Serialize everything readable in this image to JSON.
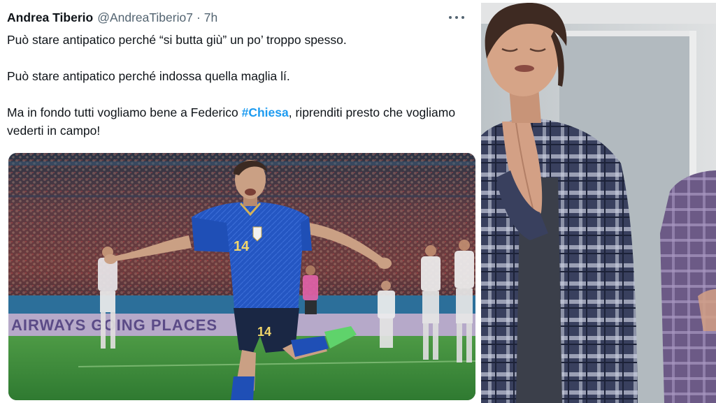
{
  "tweet": {
    "author_name": "Andrea Tiberio",
    "author_handle": "@AndreaTiberio7",
    "separator": "·",
    "time": "7h",
    "paragraphs": [
      "Può stare antipatico perché “si butta giù” un po’ troppo spesso.",
      "Può stare antipatico perché indossa quella maglia lí."
    ],
    "last_paragraph_before": "Ma in fondo tutti vogliamo bene a Federico ",
    "hashtag": "#Chiesa",
    "last_paragraph_after": ", riprenditi presto che vogliamo vederti in campo!",
    "media": {
      "jersey_number": "14",
      "banner_text": "AIRWAYS   GOING PLACES"
    }
  },
  "colors": {
    "hashtag": "#1d9bf0",
    "name": "#0f1419",
    "meta": "#536471",
    "jersey_blue": "#1f4fb6",
    "pitch_green": "#3f8a3a"
  },
  "icons": {
    "more": "more-horizontal-icon"
  }
}
